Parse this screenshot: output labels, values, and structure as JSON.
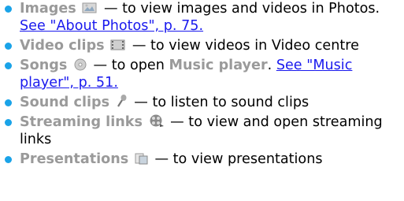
{
  "items": [
    {
      "term": "Images",
      "icon": "images-icon",
      "text": " — to view images and videos in Photos. ",
      "link": "See \"About Photos\", p. 75."
    },
    {
      "term": "Video clips",
      "icon": "video-clips-icon",
      "text": " — to view videos in Video centre"
    },
    {
      "term": "Songs",
      "icon": "songs-icon",
      "text_a": " — to open ",
      "term2": "Music player",
      "text_b": ". ",
      "link": "See \"Music player\", p. 51."
    },
    {
      "term": "Sound clips",
      "icon": "sound-clips-icon",
      "text": " — to listen to sound clips"
    },
    {
      "term": "Streaming links",
      "icon": "streaming-links-icon",
      "text": " — to view and open streaming links"
    },
    {
      "term": "Presentations",
      "icon": "presentations-icon",
      "text": " — to view presentations"
    }
  ],
  "colors": {
    "bullet": "#1aa3e8",
    "term": "#9a9a9a",
    "link": "#1a1aee"
  }
}
